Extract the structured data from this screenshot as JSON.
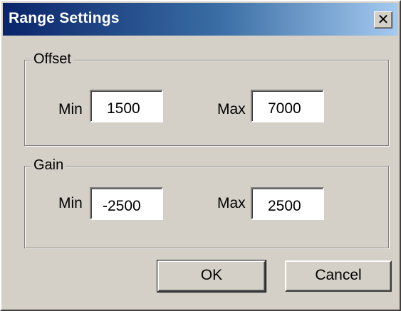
{
  "window": {
    "title": "Range Settings",
    "close_glyph": "✕",
    "close_icon": "close-icon"
  },
  "offset": {
    "legend": "Offset",
    "min_label": "Min",
    "min_value": "1500",
    "max_label": "Max",
    "max_value": "7000"
  },
  "gain": {
    "legend": "Gain",
    "min_label": "Min",
    "min_value": "-2500",
    "max_label": "Max",
    "max_value": "2500"
  },
  "buttons": {
    "ok_label": "OK",
    "cancel_label": "Cancel"
  },
  "colors": {
    "title_gradient_start": "#0a246a",
    "title_gradient_end": "#a6caf0",
    "face": "#d4d0c8"
  }
}
